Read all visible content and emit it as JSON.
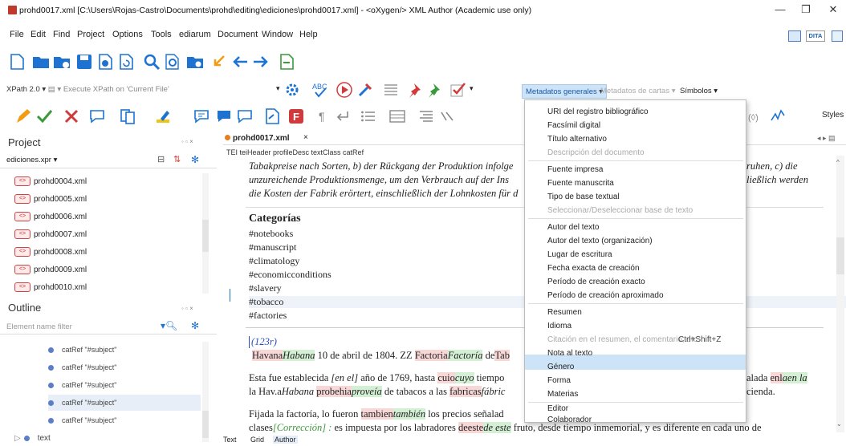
{
  "window": {
    "title": "prohd0017.xml [C:\\Users\\Rojas-Castro\\Documents\\prohd\\editing\\ediciones\\prohd0017.xml] - <oXygen/> XML Author (Academic use only)",
    "minimize": "—",
    "maximize": "❐",
    "close": "✕"
  },
  "menu": [
    "File",
    "Edit",
    "Find",
    "Project",
    "Options",
    "Tools",
    "ediarum",
    "Document",
    "Window",
    "Help"
  ],
  "right_toolbar": {
    "dita_label": "DITA"
  },
  "xpath": {
    "version": "XPath 2.0",
    "placeholder": "Execute XPath on 'Current File'"
  },
  "metadata_tabs": {
    "active": "Metadatos generales",
    "disabled": "Metadatos de cartas",
    "symbols": "Símbolos"
  },
  "styles_label": "Styles",
  "project": {
    "title": "Project",
    "project_file": "ediciones.xpr",
    "files": [
      "prohd0004.xml",
      "prohd0005.xml",
      "prohd0006.xml",
      "prohd0007.xml",
      "prohd0008.xml",
      "prohd0009.xml",
      "prohd0010.xml"
    ]
  },
  "outline": {
    "title": "Outline",
    "filter_placeholder": "Element name filter",
    "items": [
      "catRef \"#subject\"",
      "catRef \"#subject\"",
      "catRef \"#subject\"",
      "catRef \"#subject\"",
      "catRef \"#subject\""
    ],
    "last_item": "text"
  },
  "editor": {
    "tab": "prohd0017.xml",
    "breadcrumb": "TEI  teiHeader  profileDesc  textClass  catRef",
    "german_lines": [
      "Tabakpreise nach Sorten, b) der Rückgang der Produktion infolge",
      "unzureichende Produktionsmenge, um den Verbrauch auf der Ins",
      "die Kosten der Fabrik erörtert, einschließlich der Lohnkosten für d"
    ],
    "german_right": [
      "ruhen, c) die",
      "ließlich werden"
    ],
    "categories_heading": "Categorías",
    "categories": [
      "#notebooks",
      "#manuscript",
      "#climatology",
      "#economicconditions",
      "#slavery",
      "#tobacco",
      "#factories"
    ],
    "page_ref": "(123r)",
    "p1": {
      "a": "Havana",
      "b": "Habana",
      "c": " 10 de abril de 1804. ZZ ",
      "d": "Factoria",
      "e": "Factoría",
      "f": " de",
      "g": "Tab"
    },
    "p2a": {
      "a": "Esta fue establecida ",
      "b": "[en el]",
      "c": " año de 1769, hasta ",
      "d": "cuio",
      "e": "cuyo",
      "f": " tiempo"
    },
    "p2b": {
      "a": "la Hav.a",
      "b": "Habana",
      "c": " ",
      "d": "probehia",
      "e": "proveía",
      "f": " de tabacos a las ",
      "g": "fabricas",
      "h": "fábric"
    },
    "p2_right": {
      "a": "alada ",
      "b": "enl",
      "c": "aen la",
      "d": "cienda."
    },
    "p3a": {
      "a": "Fijada la factoría, lo fueron ",
      "b": "tambien",
      "c": "también",
      "d": " los precios señalad"
    },
    "p3b": {
      "a": "clases",
      "b": "[Corrección] :",
      "c": " es impuesta por los labradores ",
      "d": "deeste",
      "e": "de este",
      "f": " fruto, desde tiempo inmemorial, y es diferente en cada uno de"
    }
  },
  "dropdown": {
    "items": [
      {
        "label": "URI del registro bibliográfico",
        "disabled": false
      },
      {
        "label": "Facsímil digital",
        "disabled": false
      },
      {
        "label": "Título alternativo",
        "disabled": false
      },
      {
        "label": "Descripción del documento",
        "disabled": true
      },
      {
        "label": "Fuente impresa",
        "disabled": false
      },
      {
        "label": "Fuente manuscrita",
        "disabled": false
      },
      {
        "label": "Tipo de base textual",
        "disabled": false
      },
      {
        "label": "Seleccionar/Deseleccionar base de texto",
        "disabled": true
      },
      {
        "label": "Autor del texto",
        "disabled": false
      },
      {
        "label": "Autor del texto (organización)",
        "disabled": false
      },
      {
        "label": "Lugar de escritura",
        "disabled": false
      },
      {
        "label": "Fecha exacta de creación",
        "disabled": false
      },
      {
        "label": "Período de creación exacto",
        "disabled": false
      },
      {
        "label": "Período de creación aproximado",
        "disabled": false
      },
      {
        "label": "Resumen",
        "disabled": false
      },
      {
        "label": "Idioma",
        "disabled": false
      },
      {
        "label": "Citación en el resumen, el comentario, etc.",
        "disabled": true
      },
      {
        "label": "Nota al texto",
        "disabled": false
      },
      {
        "label": "Género",
        "disabled": false
      },
      {
        "label": "Forma",
        "disabled": false
      },
      {
        "label": "Materias",
        "disabled": false
      },
      {
        "label": "Editor",
        "disabled": false
      },
      {
        "label": "Colaborador",
        "disabled": false
      }
    ],
    "shortcut": "Ctrl+Shift+Z",
    "selected": "Género"
  },
  "bottom_tabs": [
    "Text",
    "Grid",
    "Author"
  ],
  "colors": {
    "accent": "#1e73d2",
    "selected_menu": "#cde3f7",
    "highlight_red": "#f8d7d7",
    "highlight_green": "#d4f0d4"
  }
}
